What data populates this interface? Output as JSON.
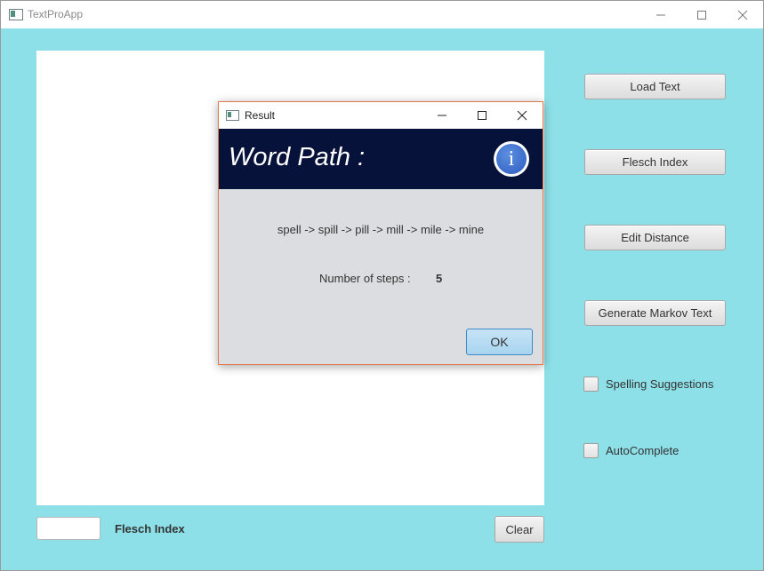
{
  "main_window": {
    "title": "TextProApp",
    "controls": {
      "minimize": "minimize",
      "maximize": "maximize",
      "close": "close"
    }
  },
  "sidebar": {
    "load_text": "Load Text",
    "flesch_index": "Flesch Index",
    "edit_distance": "Edit Distance",
    "generate_markov": "Generate Markov Text",
    "spelling_suggestions": "Spelling Suggestions",
    "autocomplete": "AutoComplete",
    "spelling_checked": false,
    "autocomplete_checked": false
  },
  "bottom": {
    "flesch_value": "",
    "flesch_label": "Flesch Index",
    "clear": "Clear"
  },
  "dialog": {
    "title": "Result",
    "header": "Word Path :",
    "info_glyph": "i",
    "path": "spell -> spill -> pill -> mill -> mile -> mine",
    "steps_label": "Number of steps :",
    "steps_value": "5",
    "ok": "OK"
  },
  "colors": {
    "background": "#8ee0e8",
    "dialog_header": "#06123a",
    "info_icon": "#2b5cc1",
    "dialog_border": "#e07a4a"
  }
}
